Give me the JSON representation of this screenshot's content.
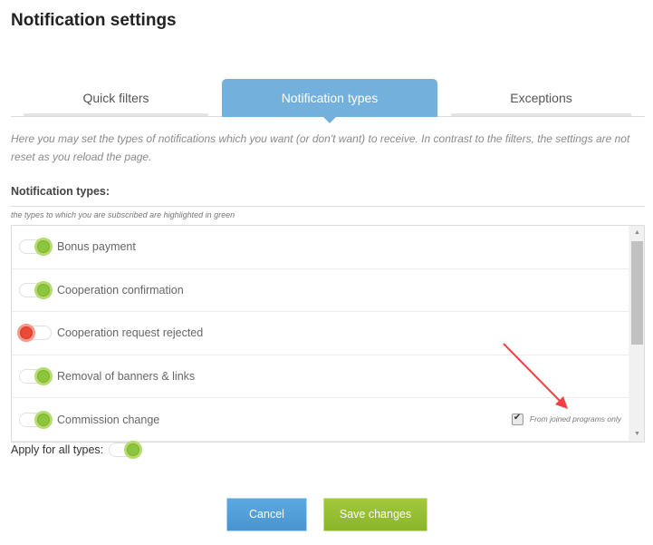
{
  "page_title": "Notification settings",
  "tabs": [
    {
      "label": "Quick filters",
      "active": false
    },
    {
      "label": "Notification types",
      "active": true
    },
    {
      "label": "Exceptions",
      "active": false
    }
  ],
  "intro_text": "Here you may set the types of notifications which you want (or don't want) to receive. In contrast to the filters, the settings are not reset as you reload the page.",
  "section": {
    "title": "Notification types:",
    "hint": "the types to which you are subscribed are highlighted in green"
  },
  "notification_types": [
    {
      "label": "Bonus payment",
      "enabled": true
    },
    {
      "label": "Cooperation confirmation",
      "enabled": true
    },
    {
      "label": "Cooperation request rejected",
      "enabled": false
    },
    {
      "label": "Removal of banners & links",
      "enabled": true
    },
    {
      "label": "Commission change",
      "enabled": true,
      "option": {
        "label": "From joined programs only",
        "checked": true
      }
    }
  ],
  "apply_all": {
    "label": "Apply for all types:",
    "enabled": true
  },
  "buttons": {
    "cancel": "Cancel",
    "save": "Save changes"
  },
  "colors": {
    "tab_active": "#73b0dc",
    "toggle_on": "#8cc63f",
    "toggle_off": "#ea4b38",
    "cancel_button": "#4f9ad6",
    "save_button": "#94bd32",
    "annotation_arrow": "#f04040"
  }
}
